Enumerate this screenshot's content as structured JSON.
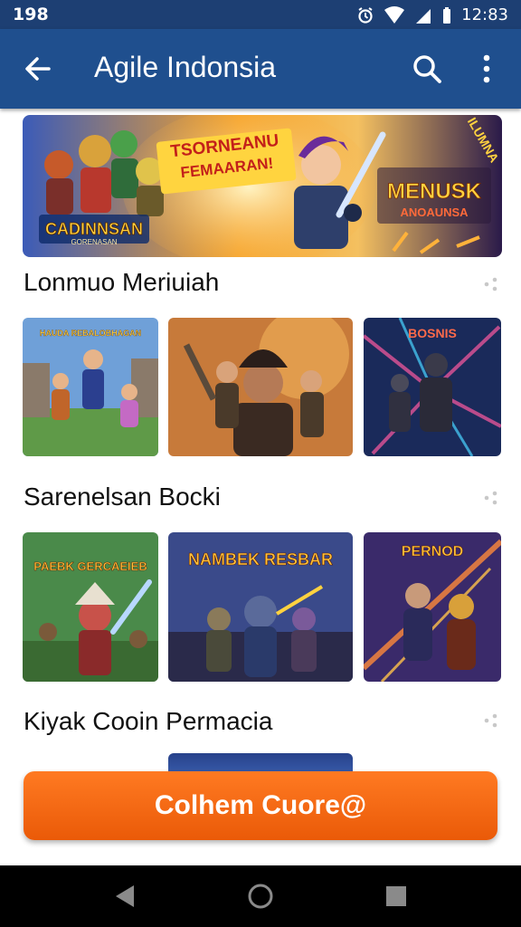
{
  "status_bar": {
    "left_text": "198",
    "time": "12:83"
  },
  "app_bar": {
    "title": "Agile Indonsia",
    "back_icon": "arrow-left-icon",
    "search_icon": "search-icon",
    "more_icon": "more-vert-icon"
  },
  "banner": {
    "left_text": "CADINNSAN",
    "left_subtext": "GORENASAN",
    "center_text_1": "TSORNEANU",
    "center_text_2": "FEMAARAN!",
    "right_text_1": "MENUSK",
    "right_text_2": "ANOAUNSA",
    "corner_text": "ILUMNA"
  },
  "sections": [
    {
      "title": "Lonmuo Meriuiah",
      "tiles": [
        {
          "caption": "HAUDA REBALOBHAGAN"
        },
        {
          "caption": ""
        },
        {
          "caption": "BOSNIS"
        }
      ]
    },
    {
      "title": "Sarenelsan Bocki",
      "tiles": [
        {
          "caption": "PAEBK GERCAEIEB"
        },
        {
          "caption": "NAMBEK RESBAR"
        },
        {
          "caption": "PERNOD"
        }
      ]
    },
    {
      "title": "Kiyak Cooin Permacia"
    }
  ],
  "cta": {
    "label": "Colhem Cuore@"
  },
  "colors": {
    "app_bar": "#1f4f8e",
    "status_bar": "#1d3f73",
    "cta": "#f06a12",
    "nav_bar": "#000000"
  }
}
